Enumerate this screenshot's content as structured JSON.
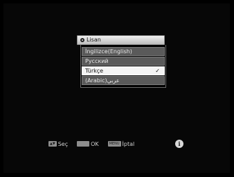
{
  "dialog": {
    "title": "Lisan",
    "items": [
      {
        "label": "İngilizce(English)",
        "selected": false
      },
      {
        "label": "Русский",
        "selected": false
      },
      {
        "label": "Türkçe",
        "selected": true,
        "check": "✓"
      },
      {
        "label": "(Arabic)عربي",
        "selected": false
      }
    ]
  },
  "help": {
    "nav_key": "▲▼",
    "nav_label": "Seç",
    "ok_key": "OK",
    "ok_label": "OK",
    "menu_key": "MENU",
    "menu_label": "İptal",
    "info_glyph": "i"
  }
}
